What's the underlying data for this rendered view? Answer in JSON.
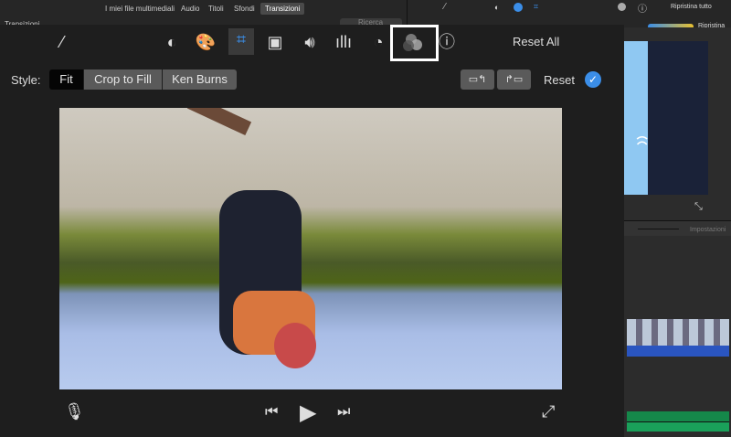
{
  "browser_tabs": [
    "I miei file multimediali",
    "Audio",
    "Titoli",
    "Sfondi",
    "Transizioni"
  ],
  "active_tab": "Transizioni",
  "section_label": "Transizioni",
  "search_placeholder": "Ricerca",
  "right_top": {
    "reset_all": "Ripristina tutto",
    "reset": "Ripristina",
    "settings": "Impostazioni"
  },
  "toolbar": {
    "icons": [
      "magic-wand",
      "color-balance",
      "color-palette",
      "crop",
      "stabilization",
      "volume",
      "equalizer",
      "speed",
      "clip-filter",
      "info"
    ],
    "selected": "crop",
    "highlighted": "clip-filter",
    "reset_all": "Reset All"
  },
  "style": {
    "label": "Style:",
    "options": [
      "Fit",
      "Crop to Fill",
      "Ken Burns"
    ],
    "selected": "Fit",
    "reset": "Reset"
  },
  "accent": "#3b8ee8"
}
